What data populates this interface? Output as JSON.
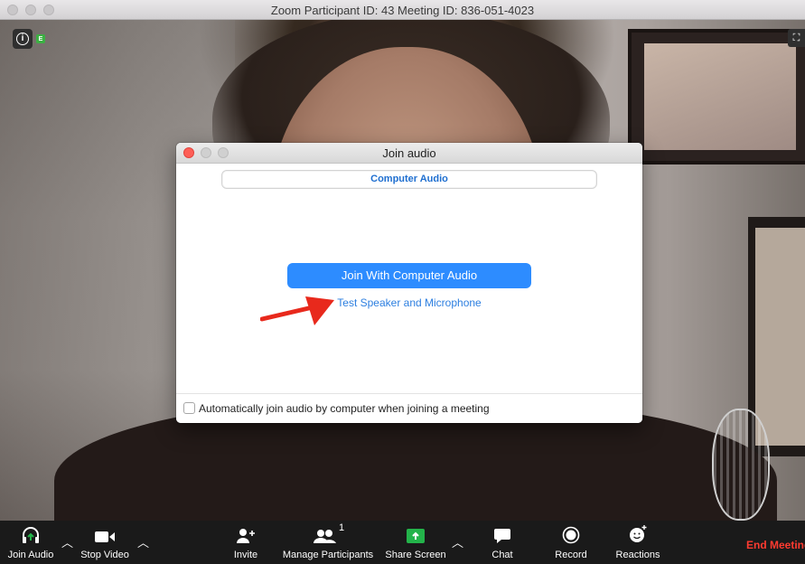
{
  "window": {
    "title": "Zoom Participant ID: 43   Meeting ID: 836-051-4023"
  },
  "video": {
    "info_icon": "info-icon",
    "encryption_badge": "E",
    "fullscreen_icon": "fullscreen-icon"
  },
  "dialog": {
    "title": "Join audio",
    "tab": "Computer Audio",
    "join_button": "Join With Computer Audio",
    "test_link": "Test Speaker and Microphone",
    "auto_join_label": "Automatically join audio by computer when joining a meeting",
    "auto_join_checked": false
  },
  "toolbar": {
    "join_audio": "Join Audio",
    "stop_video": "Stop Video",
    "invite": "Invite",
    "manage_participants": "Manage Participants",
    "participant_count": "1",
    "share_screen": "Share Screen",
    "chat": "Chat",
    "record": "Record",
    "reactions": "Reactions",
    "end_meeting": "End Meeting"
  },
  "colors": {
    "accent": "#2d8cff",
    "end_meeting": "#ff3b30",
    "share_green": "#23b34a",
    "arrow": "#e8291c"
  }
}
